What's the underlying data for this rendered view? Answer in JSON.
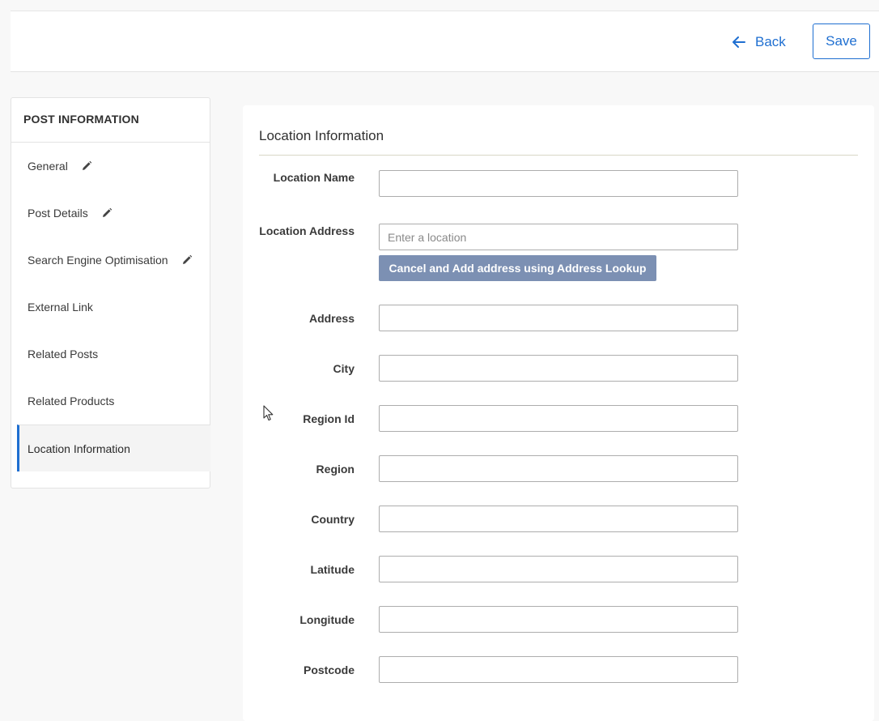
{
  "header": {
    "back_label": "Back",
    "save_label": "Save"
  },
  "sidebar": {
    "title": "POST INFORMATION",
    "items": [
      {
        "label": "General",
        "edited": true
      },
      {
        "label": "Post Details",
        "edited": true
      },
      {
        "label": "Search Engine Optimisation",
        "edited": true
      },
      {
        "label": "External Link",
        "edited": false
      },
      {
        "label": "Related Posts",
        "edited": false
      },
      {
        "label": "Related Products",
        "edited": false
      },
      {
        "label": "Location Information",
        "edited": false,
        "active": true
      }
    ]
  },
  "main": {
    "title": "Location Information",
    "lookup_button": "Cancel and Add address using Address Lookup",
    "fields": {
      "location_name": {
        "label": "Location Name",
        "value": ""
      },
      "location_address": {
        "label": "Location Address",
        "value": "",
        "placeholder": "Enter a location"
      },
      "address": {
        "label": "Address",
        "value": ""
      },
      "city": {
        "label": "City",
        "value": ""
      },
      "region_id": {
        "label": "Region Id",
        "value": ""
      },
      "region": {
        "label": "Region",
        "value": ""
      },
      "country": {
        "label": "Country",
        "value": ""
      },
      "latitude": {
        "label": "Latitude",
        "value": ""
      },
      "longitude": {
        "label": "Longitude",
        "value": ""
      },
      "postcode": {
        "label": "Postcode",
        "value": ""
      }
    }
  },
  "colors": {
    "accent": "#1f6fd1",
    "lookup_button_bg": "#7c90b3",
    "page_bg": "#f8f8f8"
  }
}
